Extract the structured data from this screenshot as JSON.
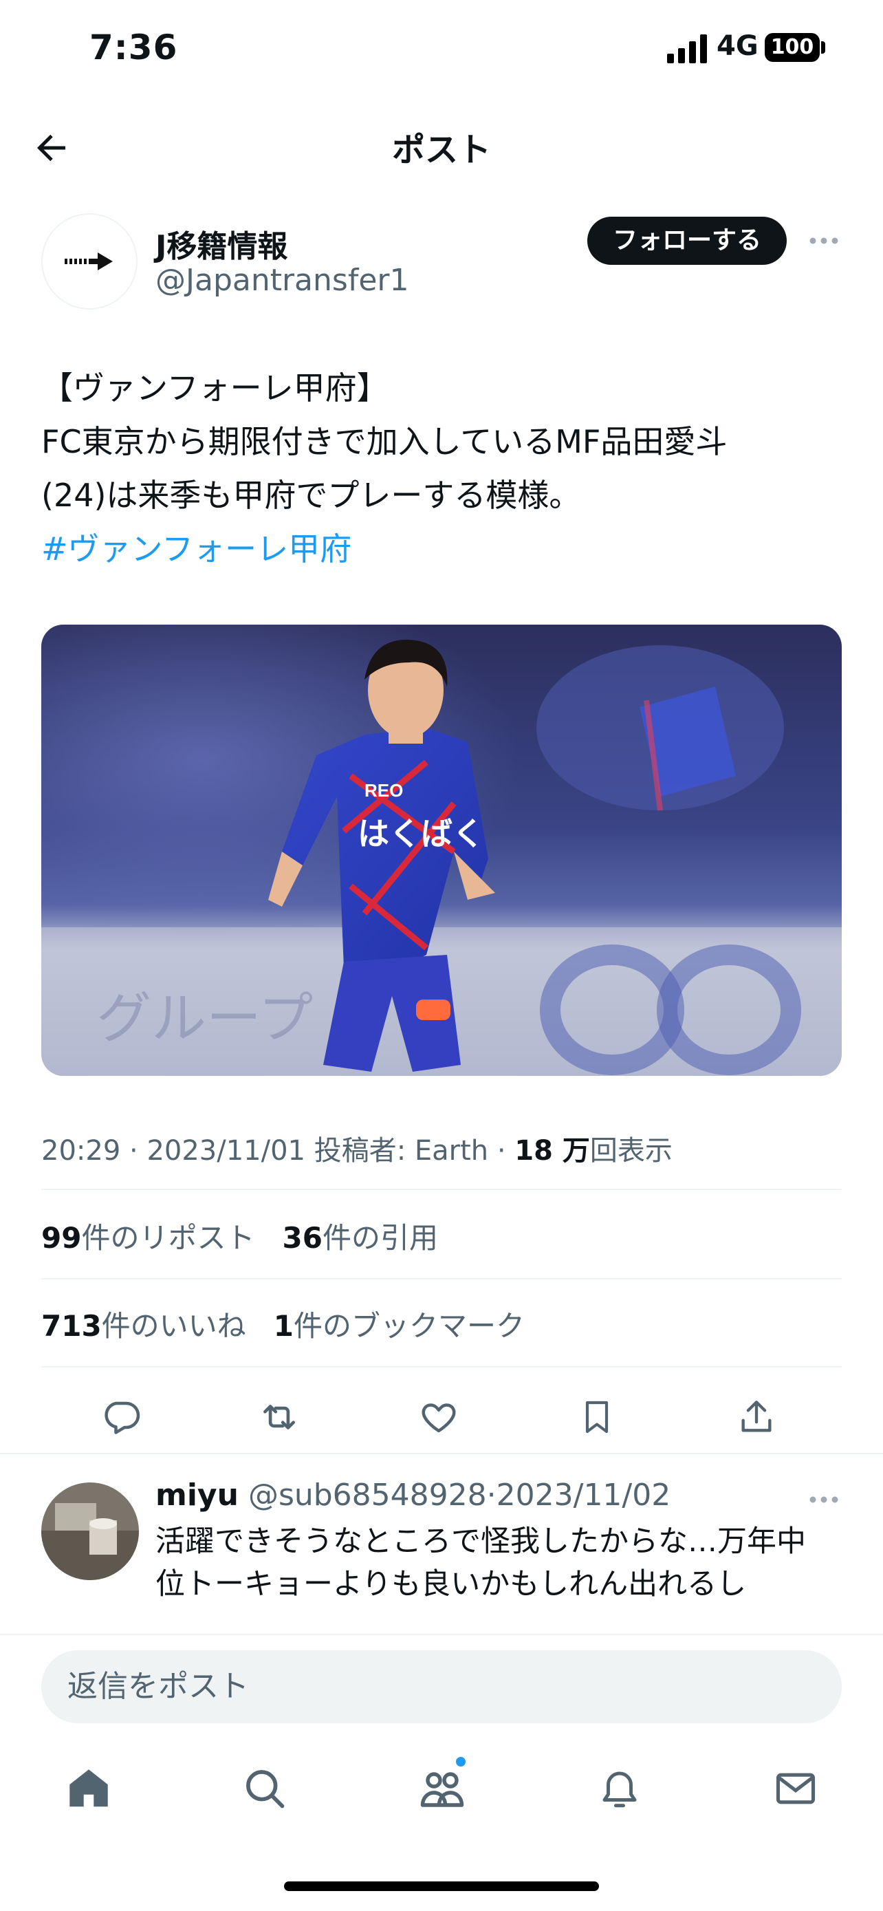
{
  "status_bar": {
    "time": "7:36",
    "network": "4G",
    "battery": "100"
  },
  "header": {
    "title": "ポスト",
    "back_icon": "arrow-left-icon"
  },
  "author": {
    "name": "J移籍情報",
    "handle": "@Japantransfer1",
    "follow_label": "フォローする",
    "avatar_icon": "arrow-right-icon"
  },
  "post": {
    "lines": [
      "【ヴァンフォーレ甲府】",
      "FC東京から期限付きで加入しているMF品田愛斗",
      "(24)は来季も甲府でプレーする模様。"
    ],
    "hashtag": "#ヴァンフォーレ甲府"
  },
  "meta": {
    "time": "20:29",
    "date": "2023/11/01",
    "poster_label": "投稿者: Earth",
    "views_count": "18 万",
    "views_label": "回表示"
  },
  "stats": {
    "reposts_count": "99",
    "reposts_label": "件のリポスト",
    "quotes_count": "36",
    "quotes_label": "件の引用",
    "likes_count": "713",
    "likes_label": "件のいいね",
    "bookmarks_count": "1",
    "bookmarks_label": "件のブックマーク"
  },
  "actions": [
    "reply-icon",
    "repost-icon",
    "like-icon",
    "bookmark-icon",
    "share-icon"
  ],
  "reply": {
    "name": "miyu",
    "handle": "@sub68548928",
    "date": "2023/11/02",
    "lines": [
      "活躍できそうなところで怪我したからな…万年中",
      "位トーキョーよりも良いかもしれん出れるし"
    ]
  },
  "composer": {
    "placeholder": "返信をポスト"
  },
  "tabbar": [
    "home-icon",
    "search-icon",
    "communities-icon",
    "notifications-icon",
    "messages-icon"
  ],
  "colors": {
    "accent": "#1d9bf0",
    "text": "#0f1419",
    "secondary": "#536471",
    "divider": "#eff3f4"
  }
}
